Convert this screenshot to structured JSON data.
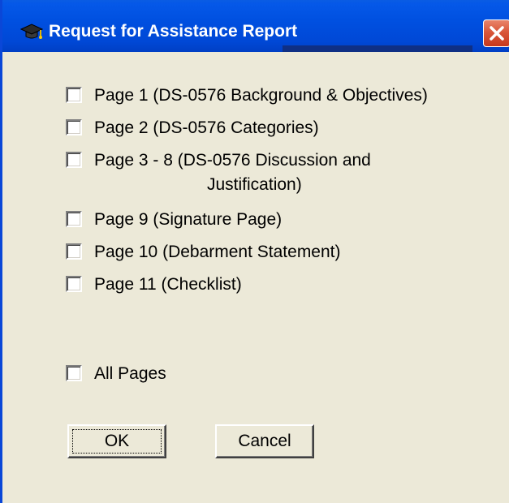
{
  "window": {
    "title": "Request for Assistance Report",
    "icon": "graduation-cap-icon",
    "close_icon": "close-icon"
  },
  "options": [
    {
      "label": "Page 1 (DS-0576 Background & Objectives)",
      "checked": false
    },
    {
      "label": "Page 2 (DS-0576 Categories)",
      "checked": false
    },
    {
      "label": "Page 3 - 8 (DS-0576 Discussion and",
      "label_line2": "Justification)",
      "checked": false
    },
    {
      "label": "Page 9 (Signature Page)",
      "checked": false
    },
    {
      "label": "Page 10 (Debarment Statement)",
      "checked": false
    },
    {
      "label": "Page 11 (Checklist)",
      "checked": false
    }
  ],
  "all_pages": {
    "label": "All Pages",
    "checked": false
  },
  "buttons": {
    "ok_label": "OK",
    "cancel_label": "Cancel"
  },
  "colors": {
    "titlebar": "#0050e0",
    "dialog_bg": "#ece9d8",
    "close_button": "#d9573a"
  }
}
